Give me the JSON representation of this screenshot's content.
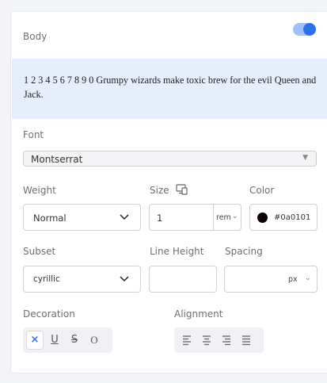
{
  "header": {
    "title": "Body",
    "toggle_on": true,
    "toggle_color": "#2f6fec"
  },
  "preview": {
    "text": "1 2 3 4 5 6 7 8 9 0 Grumpy wizards make toxic brew for the evil Queen and Jack.",
    "background": "#e6edfb"
  },
  "font": {
    "label": "Font",
    "value": "Montserrat"
  },
  "weight": {
    "label": "Weight",
    "value": "Normal"
  },
  "size": {
    "label": "Size",
    "value": "1",
    "unit": "rem"
  },
  "color": {
    "label": "Color",
    "value": "#0a0101"
  },
  "subset": {
    "label": "Subset",
    "value": "cyrillic"
  },
  "line_height": {
    "label": "Line Height",
    "value": ""
  },
  "spacing": {
    "label": "Spacing",
    "value": "",
    "unit": "px"
  },
  "decoration": {
    "label": "Decoration",
    "options": [
      {
        "name": "none",
        "glyph": "×",
        "active": true
      },
      {
        "name": "underline",
        "glyph": "U",
        "active": false
      },
      {
        "name": "strikethrough",
        "glyph": "S",
        "active": false
      },
      {
        "name": "overline",
        "glyph": "O",
        "active": false
      }
    ]
  },
  "alignment": {
    "label": "Alignment",
    "options": [
      {
        "name": "left",
        "active": false
      },
      {
        "name": "center",
        "active": false
      },
      {
        "name": "right",
        "active": false
      },
      {
        "name": "justify",
        "active": false
      }
    ]
  }
}
